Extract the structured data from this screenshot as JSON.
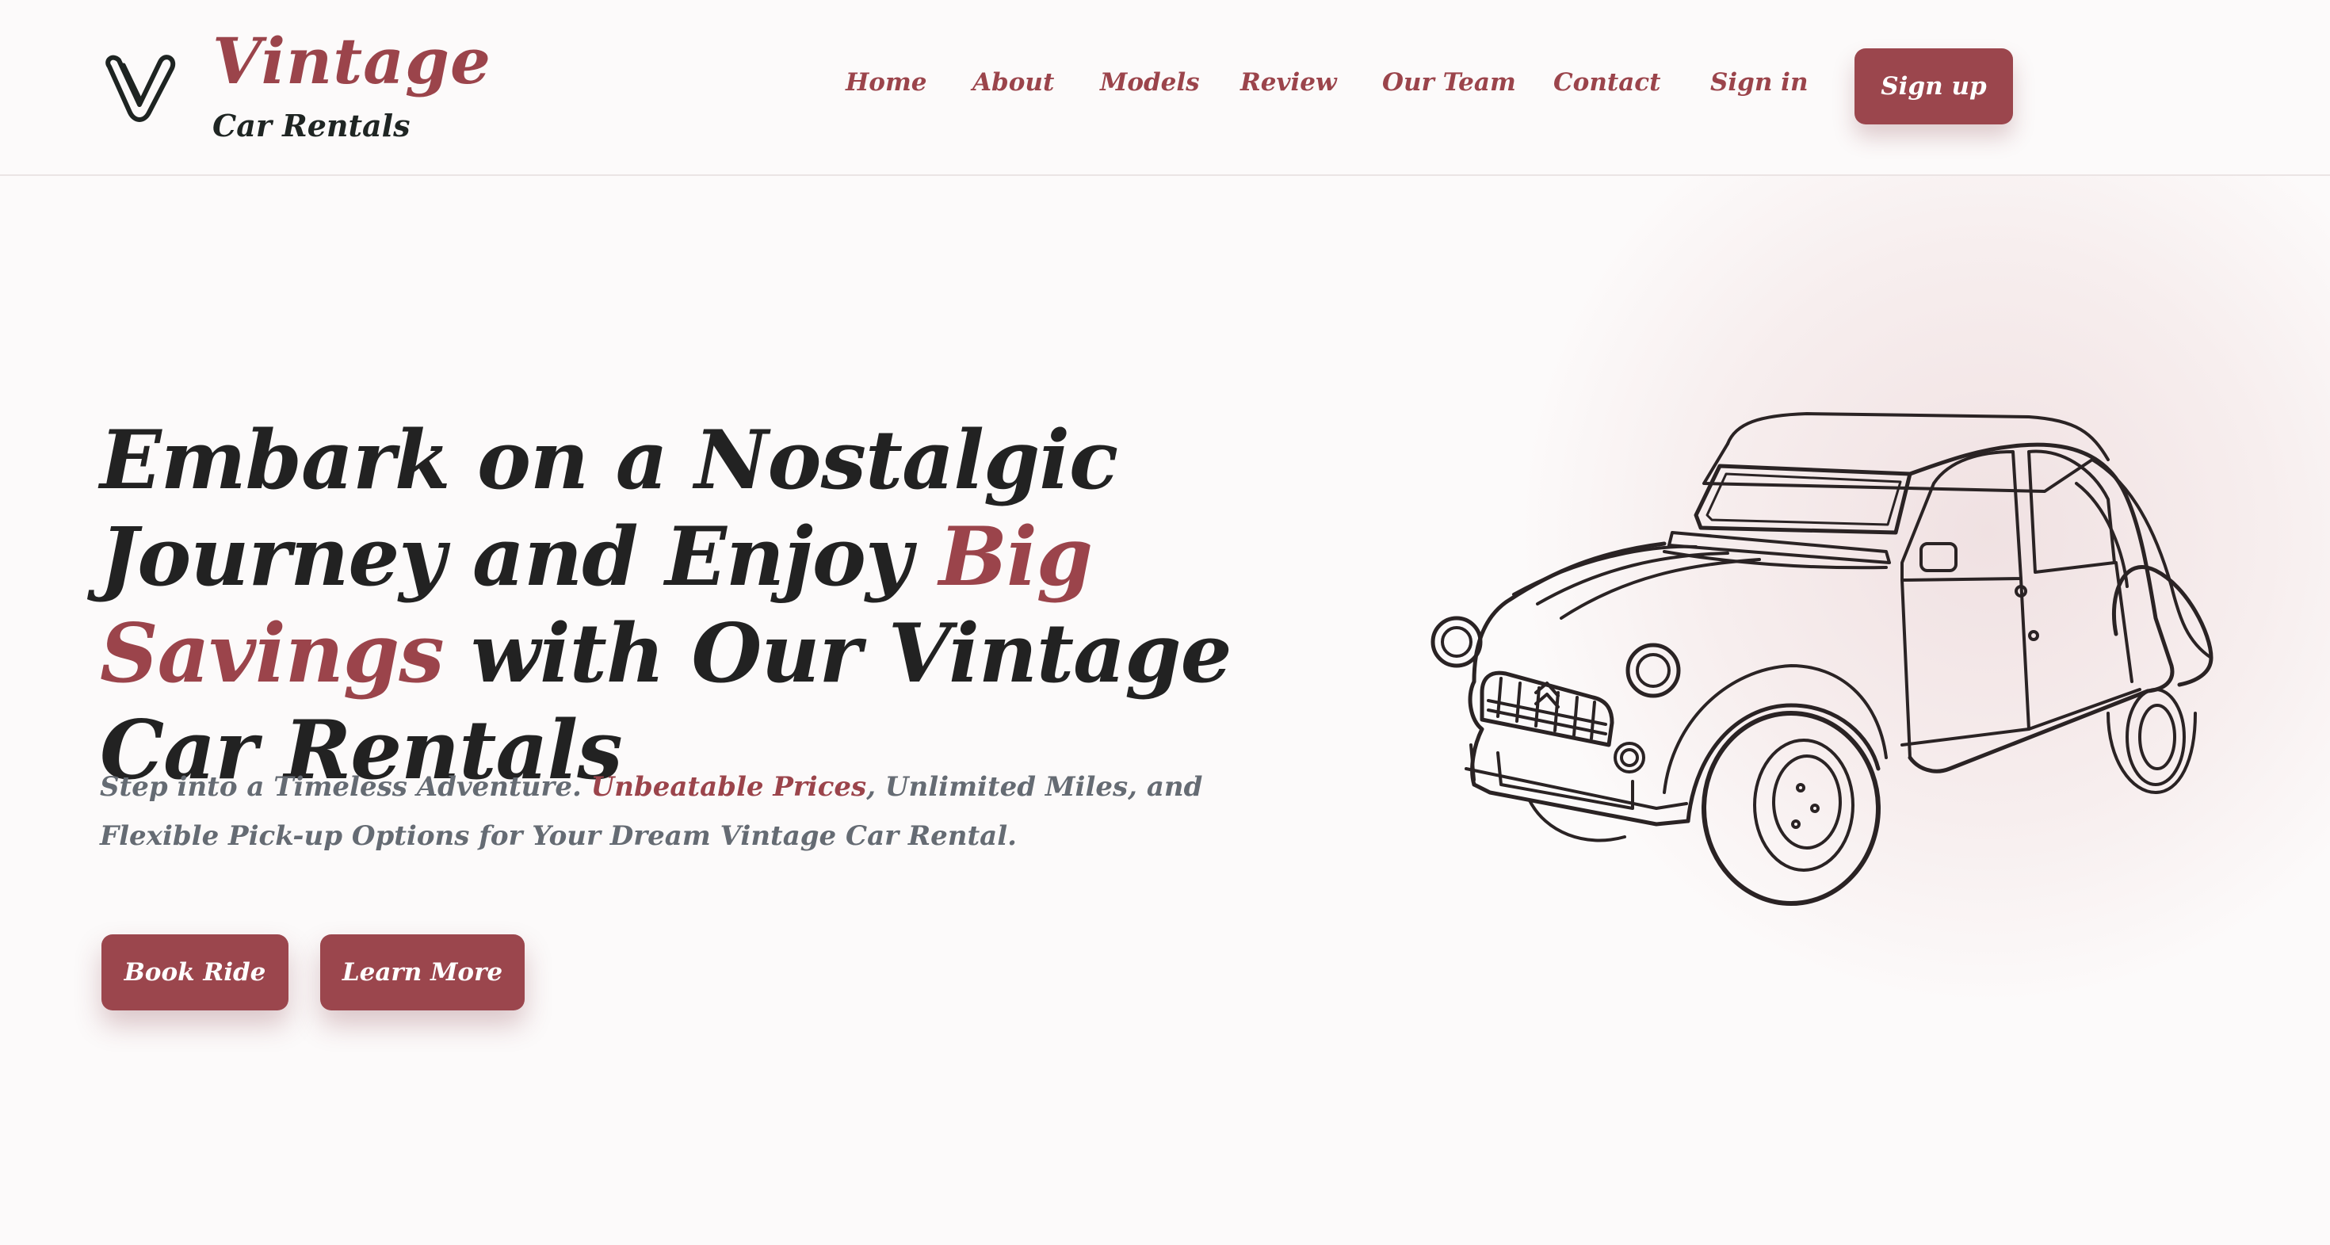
{
  "brand": {
    "name": "Vintage",
    "subtitle": "Car Rentals",
    "logo_icon": "v-logo-icon"
  },
  "nav": {
    "items": [
      {
        "label": "Home"
      },
      {
        "label": "About"
      },
      {
        "label": "Models"
      },
      {
        "label": "Review"
      },
      {
        "label": "Our Team"
      },
      {
        "label": "Contact"
      },
      {
        "label": "Sign in"
      }
    ],
    "signup_label": "Sign up"
  },
  "hero": {
    "title_part1": "Embark on a Nostalgic Journey and Enjoy ",
    "title_accent": "Big Savings",
    "title_part2": " with Our Vintage Car Rentals",
    "subtitle_part1": "Step into a Timeless Adventure. ",
    "subtitle_accent": "Unbeatable Prices",
    "subtitle_part2": ", Unlimited Miles, and Flexible Pick-up Options for Your Dream Vintage Car Rental.",
    "book_label": "Book Ride",
    "learn_label": "Learn More",
    "image_icon": "vintage-car-illustration"
  },
  "colors": {
    "accent": "#9b444b",
    "heading": "#222222",
    "body_text": "#656b73",
    "background": "#fcfafa"
  }
}
